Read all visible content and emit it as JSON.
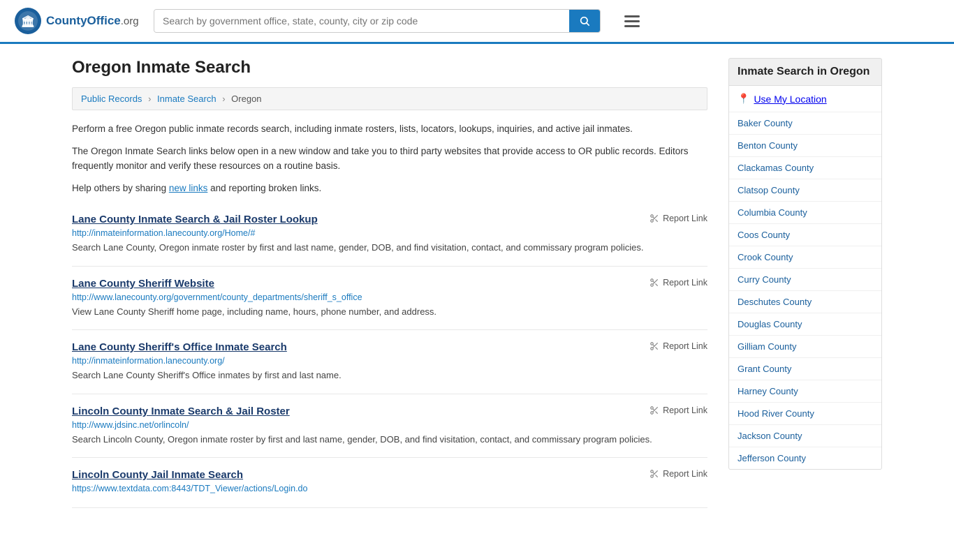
{
  "header": {
    "logo_text": "CountyOffice",
    "logo_suffix": ".org",
    "search_placeholder": "Search by government office, state, county, city or zip code",
    "menu_label": "Menu"
  },
  "page": {
    "title": "Oregon Inmate Search",
    "breadcrumb": {
      "items": [
        "Public Records",
        "Inmate Search",
        "Oregon"
      ]
    },
    "description": [
      "Perform a free Oregon public inmate records search, including inmate rosters, lists, locators, lookups, inquiries, and active jail inmates.",
      "The Oregon Inmate Search links below open in a new window and take you to third party websites that provide access to OR public records. Editors frequently monitor and verify these resources on a routine basis.",
      "Help others by sharing new links and reporting broken links."
    ],
    "new_links_text": "new links"
  },
  "results": [
    {
      "title": "Lane County Inmate Search & Jail Roster Lookup",
      "url": "http://inmateinformation.lanecounty.org/Home/#",
      "description": "Search Lane County, Oregon inmate roster by first and last name, gender, DOB, and find visitation, contact, and commissary program policies.",
      "report_label": "Report Link"
    },
    {
      "title": "Lane County Sheriff Website",
      "url": "http://www.lanecounty.org/government/county_departments/sheriff_s_office",
      "description": "View Lane County Sheriff home page, including name, hours, phone number, and address.",
      "report_label": "Report Link"
    },
    {
      "title": "Lane County Sheriff's Office Inmate Search",
      "url": "http://inmateinformation.lanecounty.org/",
      "description": "Search Lane County Sheriff's Office inmates by first and last name.",
      "report_label": "Report Link"
    },
    {
      "title": "Lincoln County Inmate Search & Jail Roster",
      "url": "http://www.jdsinc.net/orlincoln/",
      "description": "Search Lincoln County, Oregon inmate roster by first and last name, gender, DOB, and find visitation, contact, and commissary program policies.",
      "report_label": "Report Link"
    },
    {
      "title": "Lincoln County Jail Inmate Search",
      "url": "https://www.textdata.com:8443/TDT_Viewer/actions/Login.do",
      "description": "",
      "report_label": "Report Link"
    }
  ],
  "sidebar": {
    "title": "Inmate Search in Oregon",
    "location_label": "Use My Location",
    "counties": [
      "Baker County",
      "Benton County",
      "Clackamas County",
      "Clatsop County",
      "Columbia County",
      "Coos County",
      "Crook County",
      "Curry County",
      "Deschutes County",
      "Douglas County",
      "Gilliam County",
      "Grant County",
      "Harney County",
      "Hood River County",
      "Jackson County",
      "Jefferson County"
    ]
  }
}
